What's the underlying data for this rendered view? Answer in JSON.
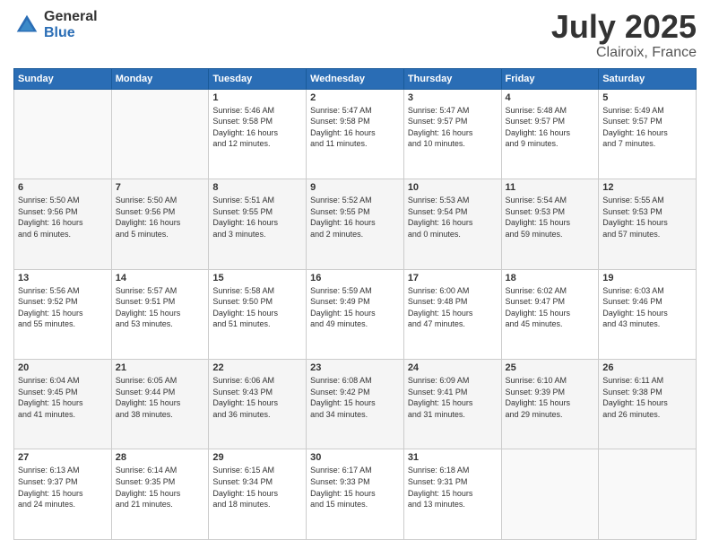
{
  "logo": {
    "general": "General",
    "blue": "Blue"
  },
  "title": "July 2025",
  "subtitle": "Clairoix, France",
  "days_header": [
    "Sunday",
    "Monday",
    "Tuesday",
    "Wednesday",
    "Thursday",
    "Friday",
    "Saturday"
  ],
  "weeks": [
    [
      {
        "num": "",
        "info": ""
      },
      {
        "num": "",
        "info": ""
      },
      {
        "num": "1",
        "info": "Sunrise: 5:46 AM\nSunset: 9:58 PM\nDaylight: 16 hours\nand 12 minutes."
      },
      {
        "num": "2",
        "info": "Sunrise: 5:47 AM\nSunset: 9:58 PM\nDaylight: 16 hours\nand 11 minutes."
      },
      {
        "num": "3",
        "info": "Sunrise: 5:47 AM\nSunset: 9:57 PM\nDaylight: 16 hours\nand 10 minutes."
      },
      {
        "num": "4",
        "info": "Sunrise: 5:48 AM\nSunset: 9:57 PM\nDaylight: 16 hours\nand 9 minutes."
      },
      {
        "num": "5",
        "info": "Sunrise: 5:49 AM\nSunset: 9:57 PM\nDaylight: 16 hours\nand 7 minutes."
      }
    ],
    [
      {
        "num": "6",
        "info": "Sunrise: 5:50 AM\nSunset: 9:56 PM\nDaylight: 16 hours\nand 6 minutes."
      },
      {
        "num": "7",
        "info": "Sunrise: 5:50 AM\nSunset: 9:56 PM\nDaylight: 16 hours\nand 5 minutes."
      },
      {
        "num": "8",
        "info": "Sunrise: 5:51 AM\nSunset: 9:55 PM\nDaylight: 16 hours\nand 3 minutes."
      },
      {
        "num": "9",
        "info": "Sunrise: 5:52 AM\nSunset: 9:55 PM\nDaylight: 16 hours\nand 2 minutes."
      },
      {
        "num": "10",
        "info": "Sunrise: 5:53 AM\nSunset: 9:54 PM\nDaylight: 16 hours\nand 0 minutes."
      },
      {
        "num": "11",
        "info": "Sunrise: 5:54 AM\nSunset: 9:53 PM\nDaylight: 15 hours\nand 59 minutes."
      },
      {
        "num": "12",
        "info": "Sunrise: 5:55 AM\nSunset: 9:53 PM\nDaylight: 15 hours\nand 57 minutes."
      }
    ],
    [
      {
        "num": "13",
        "info": "Sunrise: 5:56 AM\nSunset: 9:52 PM\nDaylight: 15 hours\nand 55 minutes."
      },
      {
        "num": "14",
        "info": "Sunrise: 5:57 AM\nSunset: 9:51 PM\nDaylight: 15 hours\nand 53 minutes."
      },
      {
        "num": "15",
        "info": "Sunrise: 5:58 AM\nSunset: 9:50 PM\nDaylight: 15 hours\nand 51 minutes."
      },
      {
        "num": "16",
        "info": "Sunrise: 5:59 AM\nSunset: 9:49 PM\nDaylight: 15 hours\nand 49 minutes."
      },
      {
        "num": "17",
        "info": "Sunrise: 6:00 AM\nSunset: 9:48 PM\nDaylight: 15 hours\nand 47 minutes."
      },
      {
        "num": "18",
        "info": "Sunrise: 6:02 AM\nSunset: 9:47 PM\nDaylight: 15 hours\nand 45 minutes."
      },
      {
        "num": "19",
        "info": "Sunrise: 6:03 AM\nSunset: 9:46 PM\nDaylight: 15 hours\nand 43 minutes."
      }
    ],
    [
      {
        "num": "20",
        "info": "Sunrise: 6:04 AM\nSunset: 9:45 PM\nDaylight: 15 hours\nand 41 minutes."
      },
      {
        "num": "21",
        "info": "Sunrise: 6:05 AM\nSunset: 9:44 PM\nDaylight: 15 hours\nand 38 minutes."
      },
      {
        "num": "22",
        "info": "Sunrise: 6:06 AM\nSunset: 9:43 PM\nDaylight: 15 hours\nand 36 minutes."
      },
      {
        "num": "23",
        "info": "Sunrise: 6:08 AM\nSunset: 9:42 PM\nDaylight: 15 hours\nand 34 minutes."
      },
      {
        "num": "24",
        "info": "Sunrise: 6:09 AM\nSunset: 9:41 PM\nDaylight: 15 hours\nand 31 minutes."
      },
      {
        "num": "25",
        "info": "Sunrise: 6:10 AM\nSunset: 9:39 PM\nDaylight: 15 hours\nand 29 minutes."
      },
      {
        "num": "26",
        "info": "Sunrise: 6:11 AM\nSunset: 9:38 PM\nDaylight: 15 hours\nand 26 minutes."
      }
    ],
    [
      {
        "num": "27",
        "info": "Sunrise: 6:13 AM\nSunset: 9:37 PM\nDaylight: 15 hours\nand 24 minutes."
      },
      {
        "num": "28",
        "info": "Sunrise: 6:14 AM\nSunset: 9:35 PM\nDaylight: 15 hours\nand 21 minutes."
      },
      {
        "num": "29",
        "info": "Sunrise: 6:15 AM\nSunset: 9:34 PM\nDaylight: 15 hours\nand 18 minutes."
      },
      {
        "num": "30",
        "info": "Sunrise: 6:17 AM\nSunset: 9:33 PM\nDaylight: 15 hours\nand 15 minutes."
      },
      {
        "num": "31",
        "info": "Sunrise: 6:18 AM\nSunset: 9:31 PM\nDaylight: 15 hours\nand 13 minutes."
      },
      {
        "num": "",
        "info": ""
      },
      {
        "num": "",
        "info": ""
      }
    ]
  ]
}
